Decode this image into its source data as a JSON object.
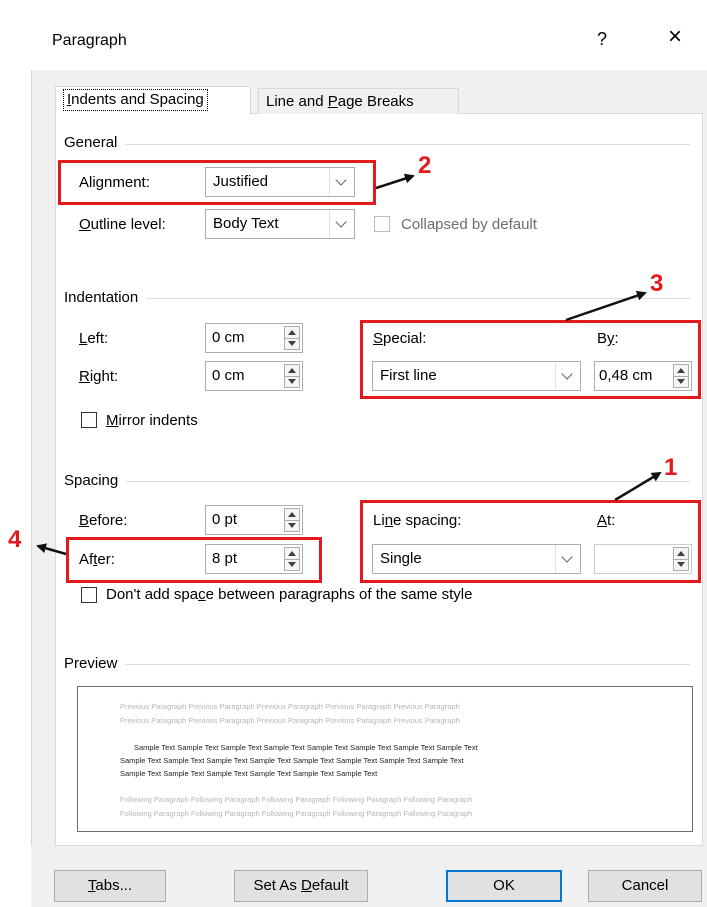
{
  "dialog": {
    "title": "Paragraph",
    "help_label": "?",
    "close_label": "×"
  },
  "tabs": [
    {
      "label_pre": "",
      "label_key": "I",
      "label_post": "ndents and Spacing",
      "active": true
    },
    {
      "label_pre": "Line and ",
      "label_key": "P",
      "label_post": "age Breaks",
      "active": false
    }
  ],
  "general": {
    "heading": "General",
    "alignment_label_pre": "Ali",
    "alignment_label_key": "g",
    "alignment_label_post": "nment:",
    "alignment_value": "Justified",
    "outline_label_pre": "",
    "outline_label_key": "O",
    "outline_label_post": "utline level:",
    "outline_value": "Body Text",
    "collapsed_label": "Collapsed by default"
  },
  "indentation": {
    "heading": "Indentation",
    "left_label_key": "L",
    "left_label_post": "eft:",
    "left_value": "0 cm",
    "right_label_key": "R",
    "right_label_post": "ight:",
    "right_value": "0 cm",
    "special_label_key": "S",
    "special_label_post": "pecial:",
    "special_value": "First line",
    "by_label_pre": "B",
    "by_label_key": "y",
    "by_label_post": ":",
    "by_value": "0,48 cm",
    "mirror_key": "M",
    "mirror_post": "irror indents"
  },
  "spacing": {
    "heading": "Spacing",
    "before_label_key": "B",
    "before_label_post": "efore:",
    "before_value": "0 pt",
    "after_label_pre": "Af",
    "after_label_key": "t",
    "after_label_post": "er:",
    "after_value": "8 pt",
    "line_spacing_pre": "Li",
    "line_spacing_key": "n",
    "line_spacing_post": "e spacing:",
    "line_spacing_value": "Single",
    "at_label_key": "A",
    "at_label_post": "t:",
    "at_value": "",
    "dont_add_pre": "Don't add spa",
    "dont_add_key": "c",
    "dont_add_post": "e between paragraphs of the same style"
  },
  "preview": {
    "heading": "Preview",
    "prev_line1": "Previous Paragraph Previous Paragraph Previous Paragraph Previous Paragraph Previous Paragraph",
    "prev_line2": "Previous Paragraph Previous Paragraph Previous Paragraph Previous Paragraph Previous Paragraph",
    "sample_line1": "Sample Text Sample Text Sample Text Sample Text Sample Text Sample Text Sample Text Sample Text",
    "sample_line2": "Sample Text Sample Text Sample Text Sample Text Sample Text Sample Text Sample Text Sample Text",
    "sample_line3": "Sample Text Sample Text Sample Text Sample Text Sample Text Sample Text",
    "follow_line1": "Following Paragraph Following Paragraph Following Paragraph Following Paragraph Following Paragraph",
    "follow_line2": "Following Paragraph Following Paragraph Following Paragraph Following Paragraph Following Paragraph"
  },
  "buttons": {
    "tabs_key": "T",
    "tabs_post": "abs...",
    "set_default_pre": "Set As ",
    "set_default_key": "D",
    "set_default_post": "efault",
    "ok": "OK",
    "cancel": "Cancel"
  },
  "annotations": {
    "n1": "1",
    "n2": "2",
    "n3": "3",
    "n4": "4",
    "color": "#e31a1c"
  },
  "colors": {
    "dialog_bg": "#f0f0f0",
    "panel_bg": "#ffffff",
    "default_button_border": "#0078d7"
  }
}
